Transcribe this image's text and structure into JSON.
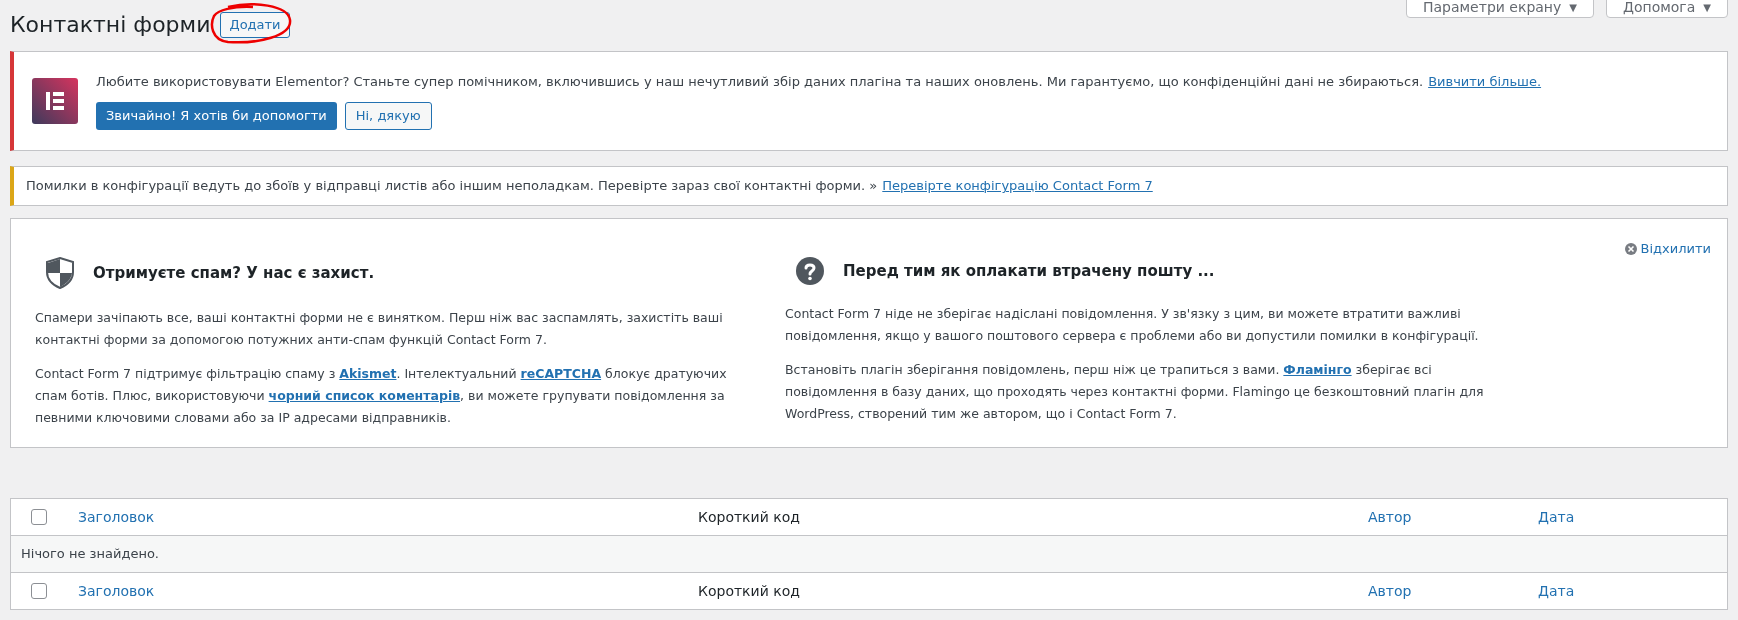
{
  "header": {
    "title": "Контактні форми",
    "add_button": "Додати",
    "annotated": true
  },
  "top_buttons": [
    {
      "label": "Параметри екрану",
      "caret": "▼"
    },
    {
      "label": "Допомога",
      "caret": "▼"
    }
  ],
  "elementor_notice": {
    "text": "Любите використовувати Elementor? Станьте супер помічником, включившись у наш нечутливий збір даних плагіна та наших оновлень. Ми гарантуємо, що конфіденційні дані не збираються.",
    "link": "Вивчити більше.",
    "primary_button": "Звичайно! Я хотів би допомогти",
    "secondary_button": "Ні, дякую"
  },
  "config_notice": {
    "text": "Помилки в конфігурації ведуть до збоїв у відправці листів або іншим неполадкам. Перевірте зараз свої контактні форми. »",
    "link": "Перевірте конфігурацію Contact Form 7"
  },
  "welcome_panel": {
    "dismiss": "Відхилити",
    "columns": [
      {
        "heading": "Отримуєте спам? У нас є захист.",
        "paragraphs": [
          [
            {
              "text": "Спамери зачіпають все, ваші контактні форми не є винятком. Перш ніж вас заспамлять, захистіть ваші контактні форми за допомогою потужних анти-спам функцій Contact Form 7.",
              "link": false
            }
          ],
          [
            {
              "text": "Contact Form 7 підтримує фільтрацію спаму з ",
              "link": false
            },
            {
              "text": "Akismet",
              "link": true
            },
            {
              "text": ". Інтелектуальний ",
              "link": false
            },
            {
              "text": "reCAPTCHA",
              "link": true
            },
            {
              "text": " блокує дратуючих спам ботів. Плюс, використовуючи ",
              "link": false
            },
            {
              "text": "чорний список коментарів",
              "link": true
            },
            {
              "text": ", ви можете групувати повідомлення за певними ключовими словами або за IP адресами відправників.",
              "link": false
            }
          ]
        ]
      },
      {
        "heading": "Перед тим як оплакати втрачену пошту ...",
        "paragraphs": [
          [
            {
              "text": "Contact Form 7 ніде не зберігає надіслані повідомлення. У зв'язку з цим, ви можете втратити важливі повідомлення, якщо у вашого поштового сервера є проблеми або ви допустили помилки в конфігурації.",
              "link": false
            }
          ],
          [
            {
              "text": "Встановіть плагін зберігання повідомлень, перш ніж це трапиться з вами. ",
              "link": false
            },
            {
              "text": "Фламінго",
              "link": true
            },
            {
              "text": " зберігає всі повідомлення в базу даних, що проходять через контактні форми. Flamingo це безкоштовний плагін для WordPress, створений тим же автором, що і Contact Form 7.",
              "link": false
            }
          ]
        ]
      }
    ]
  },
  "table": {
    "columns": [
      {
        "label": "Заголовок",
        "sortable": true
      },
      {
        "label": "Короткий код",
        "sortable": false
      },
      {
        "label": "Автор",
        "sortable": true
      },
      {
        "label": "Дата",
        "sortable": true
      }
    ],
    "header_checkbox": {
      "checked": false
    },
    "empty_message": "Нічого не знайдено.",
    "footer_columns": [
      {
        "label": "Заголовок",
        "sortable": true
      },
      {
        "label": "Короткий код",
        "sortable": false
      },
      {
        "label": "Автор",
        "sortable": true
      },
      {
        "label": "Дата",
        "sortable": true
      }
    ],
    "footer_checkbox": {
      "checked": false
    }
  }
}
